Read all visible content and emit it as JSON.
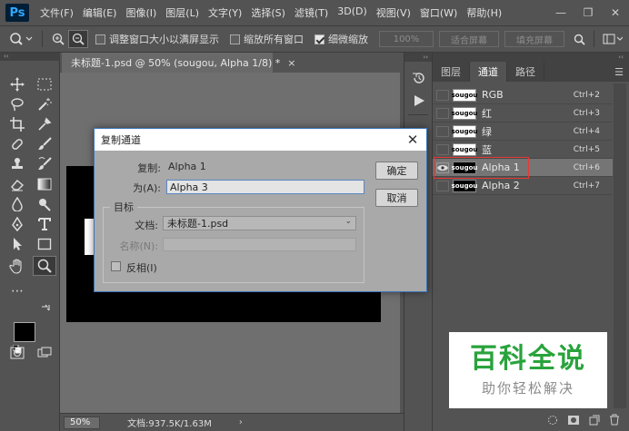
{
  "app": {
    "logo": "Ps",
    "menu": [
      "文件(F)",
      "编辑(E)",
      "图像(I)",
      "图层(L)",
      "文字(Y)",
      "选择(S)",
      "滤镜(T)",
      "3D(D)",
      "视图(V)",
      "窗口(W)",
      "帮助(H)"
    ],
    "window_controls": [
      "minimize-icon",
      "restore-icon",
      "close-icon"
    ]
  },
  "options": {
    "resize_windows_label": "调整窗口大小以满屏显示",
    "resize_windows_checked": false,
    "zoom_all_label": "缩放所有窗口",
    "zoom_all_checked": false,
    "scrubby_label": "细微缩放",
    "scrubby_checked": true,
    "zoom_percent": "100%",
    "fit_screen": "适合屏幕",
    "fill_screen": "填充屏幕"
  },
  "document": {
    "tab_title": "未标题-1.psd @ 50% (sougou, Alpha 1/8) *",
    "zoom": "50%",
    "doc_info": "文档:937.5K/1.63M"
  },
  "panel": {
    "tabs": [
      "图层",
      "通道",
      "路径"
    ],
    "active_tab": "通道",
    "channels": [
      {
        "name": "RGB",
        "shortcut": "Ctrl+2",
        "thumb_text": "sougou",
        "thumb_dark": false,
        "visible": false
      },
      {
        "name": "红",
        "shortcut": "Ctrl+3",
        "thumb_text": "sougou",
        "thumb_dark": false,
        "visible": false
      },
      {
        "name": "绿",
        "shortcut": "Ctrl+4",
        "thumb_text": "sougou",
        "thumb_dark": false,
        "visible": false
      },
      {
        "name": "蓝",
        "shortcut": "Ctrl+5",
        "thumb_text": "sougou",
        "thumb_dark": false,
        "visible": false
      },
      {
        "name": "Alpha 1",
        "shortcut": "Ctrl+6",
        "thumb_text": "sougou",
        "thumb_dark": true,
        "visible": true,
        "selected": true
      },
      {
        "name": "Alpha 2",
        "shortcut": "Ctrl+7",
        "thumb_text": "sougou",
        "thumb_dark": true,
        "visible": false
      }
    ]
  },
  "dialog": {
    "title": "复制通道",
    "source_label": "复制:",
    "source_value": "Alpha 1",
    "as_label": "为(A):",
    "as_value": "Alpha 3",
    "ok_button": "确定",
    "cancel_button": "取消",
    "group_title": "目标",
    "document_label": "文档:",
    "document_value": "未标题-1.psd",
    "name_label": "名称(N):",
    "invert_label": "反相(I)",
    "invert_checked": false
  },
  "watermark": {
    "title": "百科全说",
    "subtitle": "助你轻松解决"
  },
  "colors": {
    "ui_bg": "#535353",
    "accent_blue": "#31a8ff",
    "highlight_red": "#e53935",
    "watermark_green": "#29a33c"
  }
}
